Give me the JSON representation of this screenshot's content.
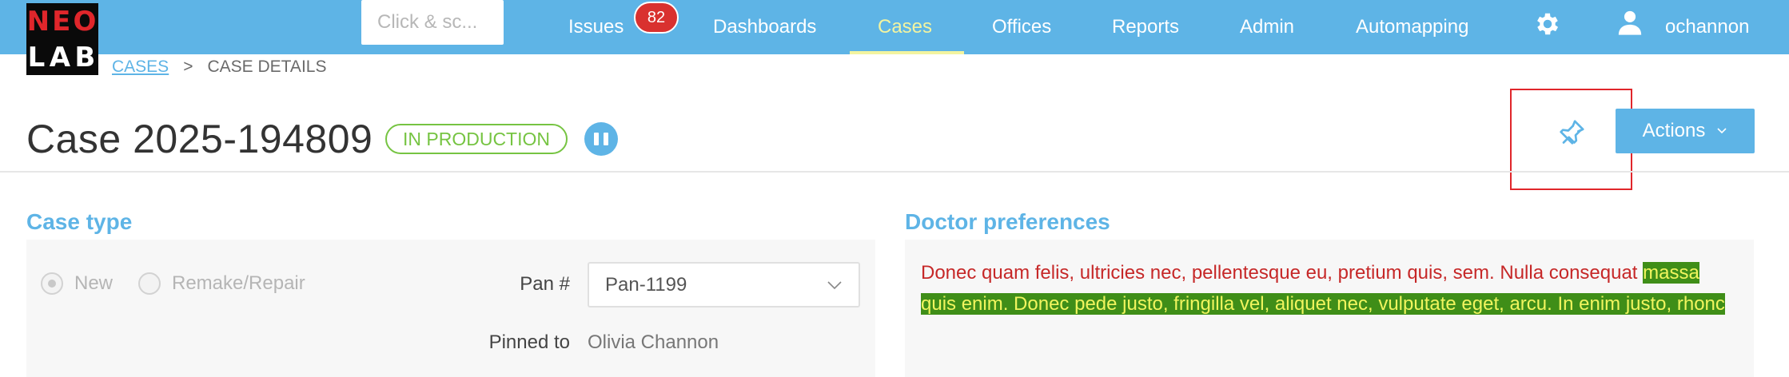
{
  "logo": {
    "line1": "NEO",
    "line2": "LAB"
  },
  "header": {
    "search_placeholder": "Click & sc...",
    "nav": [
      {
        "label": "Issues",
        "badge": "82"
      },
      {
        "label": "Dashboards"
      },
      {
        "label": "Cases",
        "active": true
      },
      {
        "label": "Offices"
      },
      {
        "label": "Reports"
      },
      {
        "label": "Admin"
      },
      {
        "label": "Automapping"
      }
    ],
    "username": "ochannon",
    "settings_icon": "gear-icon",
    "user_icon": "user-icon"
  },
  "breadcrumb": {
    "root": "CASES",
    "separator": ">",
    "current": "CASE DETAILS"
  },
  "case": {
    "title": "Case 2025-194809",
    "status": "IN PRODUCTION",
    "pause_icon": "pause-icon",
    "pin_icon": "pin-icon",
    "actions_label": "Actions"
  },
  "case_type": {
    "title": "Case type",
    "options": [
      {
        "label": "New",
        "checked": true
      },
      {
        "label": "Remake/Repair",
        "checked": false
      }
    ],
    "pan_label": "Pan #",
    "pan_value": "Pan-1199",
    "pinned_label": "Pinned to",
    "pinned_value": "Olivia Channon"
  },
  "doctor_preferences": {
    "title": "Doctor preferences",
    "text_plain": "Donec quam felis, ultricies nec, pellentesque eu, pretium quis, sem. Nulla consequat ",
    "text_highlighted": "massa quis enim. Donec pede justo, fringilla vel, aliquet nec, vulputate eget, arcu. In enim justo, rhonc"
  },
  "colors": {
    "brand_blue": "#5eb4e6",
    "status_green": "#76c442",
    "badge_red": "#d9312f",
    "nav_active": "#f3f4a0",
    "pref_red": "#c62828",
    "highlight_bg": "#3f8e18",
    "highlight_fg": "#f1f55e"
  }
}
